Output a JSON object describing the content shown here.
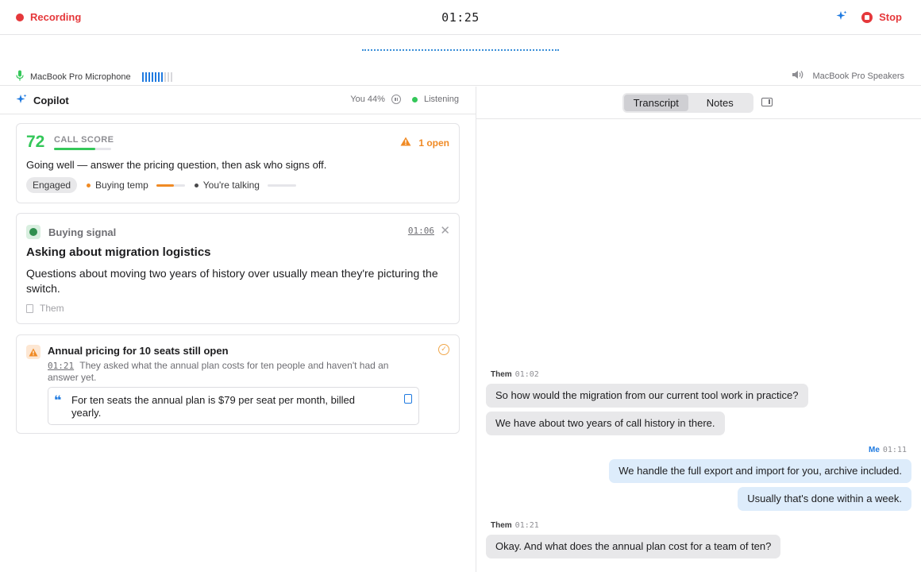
{
  "topbar": {
    "recording_label": "Recording",
    "timer": "01:25",
    "stop_label": "Stop"
  },
  "audio": {
    "microphone": "MacBook Pro Microphone",
    "mic_level_on": 7,
    "mic_level_total": 10,
    "speakers": "MacBook Pro Speakers"
  },
  "copilot": {
    "title": "Copilot",
    "talk_share": "You 44%",
    "status": "Listening"
  },
  "score": {
    "value": "72",
    "label": "CALL SCORE",
    "fill_fraction": 0.72,
    "open_count": "1 open",
    "summary": "Going well — answer the pricing question, then ask who signs off.",
    "sentiment": "Engaged",
    "buying_temp_label": "Buying temp",
    "buying_temp_fraction": 0.62,
    "talking_label": "You're talking",
    "talking_fraction": 0.0
  },
  "signal": {
    "type": "Buying signal",
    "timestamp": "01:06",
    "title": "Asking about migration logistics",
    "body": "Questions about moving two years of history over usually mean they're picturing the switch.",
    "source": "Them"
  },
  "open_item": {
    "title": "Annual pricing for 10 seats still open",
    "timestamp": "01:21",
    "detail": "They asked what the annual plan costs for ten people and haven't had an answer yet.",
    "suggested_answer": "For ten seats the annual plan is $79 per seat per month, billed yearly."
  },
  "tabs": {
    "transcript": "Transcript",
    "notes": "Notes",
    "active": "Transcript"
  },
  "transcript": [
    {
      "speaker": "Them",
      "time": "01:02",
      "lines": [
        "So how would the migration from our current tool work in practice?",
        "We have about two years of call history in there."
      ]
    },
    {
      "speaker": "Me",
      "time": "01:11",
      "lines": [
        "We handle the full export and import for you, archive included.",
        "Usually that's done within a week."
      ]
    },
    {
      "speaker": "Them",
      "time": "01:21",
      "lines": [
        "Okay. And what does the annual plan cost for a team of ten?"
      ]
    }
  ],
  "colors": {
    "recording_red": "#e5383b",
    "score_green": "#34c759",
    "warning_orange": "#f08a24",
    "accent_blue": "#1f7ae0"
  },
  "icons": {
    "sparkle": "sparkle-icon",
    "mic": "microphone-icon",
    "speaker": "speaker-icon",
    "warning": "warning-icon",
    "close": "close-icon",
    "copy": "copy-icon",
    "quote": "quote-icon",
    "document": "document-icon",
    "check": "check-circle-icon",
    "pause": "pause-icon",
    "sidebar": "sidebar-toggle-icon"
  }
}
